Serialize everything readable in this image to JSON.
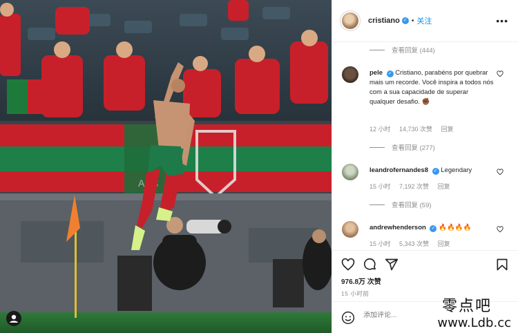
{
  "post": {
    "username": "cristiano",
    "follow_label": "关注",
    "likes": "976.8万 次赞",
    "time": "15 小时前",
    "comment_placeholder": "添加评论..."
  },
  "replies": [
    {
      "label": "查看回复 (444)"
    },
    {
      "label": "查看回复 (277)"
    },
    {
      "label": "查看回复 (59)"
    }
  ],
  "comments": [
    {
      "username": "pele",
      "text": "Cristiano, parabéns por quebrar mais um recorde. Você inspira a todos nós com a sua capacidade de superar qualquer desafio. ✊🏾",
      "time": "12 小时",
      "likes": "14,730 次赞",
      "reply": "回复"
    },
    {
      "username": "leandrofernandes8",
      "text": "Legendary",
      "time": "15 小时",
      "likes": "7,192 次赞",
      "reply": "回复"
    },
    {
      "username": "andrewhenderson",
      "text": "🔥🔥🔥🔥",
      "time": "15 小时",
      "likes": "5,343 次赞",
      "reply": "回复"
    }
  ],
  "watermark": {
    "cn": "零点吧",
    "url": "www.Ldb.cc"
  },
  "icons": {
    "more": "more-options-icon",
    "heart": "heart-icon",
    "comment": "comment-icon",
    "share": "share-icon",
    "bookmark": "bookmark-icon",
    "emoji": "emoji-icon"
  },
  "colors": {
    "accent": "#0095f6",
    "verified": "#3897f0",
    "muted": "#8e8e8e"
  }
}
